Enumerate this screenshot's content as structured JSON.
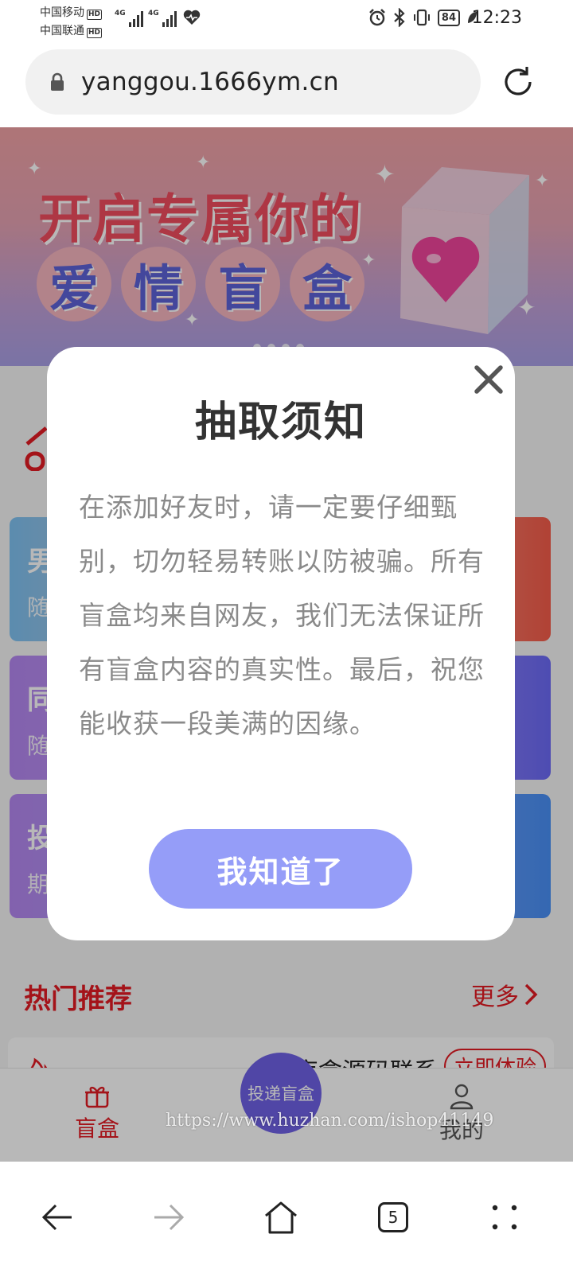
{
  "status_bar": {
    "carrier1": "中国移动",
    "carrier2": "中国联通",
    "hd_label": "HD",
    "network1": "4G",
    "network2": "4G",
    "battery": "84",
    "time": "12:23"
  },
  "browser": {
    "url": "yanggou.1666ym.cn",
    "tab_count": "5"
  },
  "banner": {
    "line1": "开启专属你的",
    "line2_chars": [
      "爱",
      "情",
      "盲",
      "盒"
    ]
  },
  "cards": [
    {
      "title": "男",
      "subtitle": "随"
    },
    {
      "title": "同",
      "subtitle": "随"
    },
    {
      "title": "投",
      "subtitle": "期"
    }
  ],
  "hot": {
    "title": "热门推荐",
    "more": "更多",
    "item_text": "盲盒源码联系",
    "item_button": "立即体验"
  },
  "tabbar": {
    "home": "盲盒",
    "center": "投递盲盒",
    "me": "我的"
  },
  "modal": {
    "title": "抽取须知",
    "body": "在添加好友时，请一定要仔细甄别，切勿轻易转账以防被骗。所有盲盒均来自网友，我们无法保证所有盲盒内容的真实性。最后，祝您能收获一段美满的因缘。",
    "button": "我知道了"
  },
  "watermark": "https://www.huzhan.com/ishop41149",
  "colors": {
    "accent_red": "#e31b23",
    "modal_button": "#959df8",
    "center_tab": "#6f62e6"
  }
}
